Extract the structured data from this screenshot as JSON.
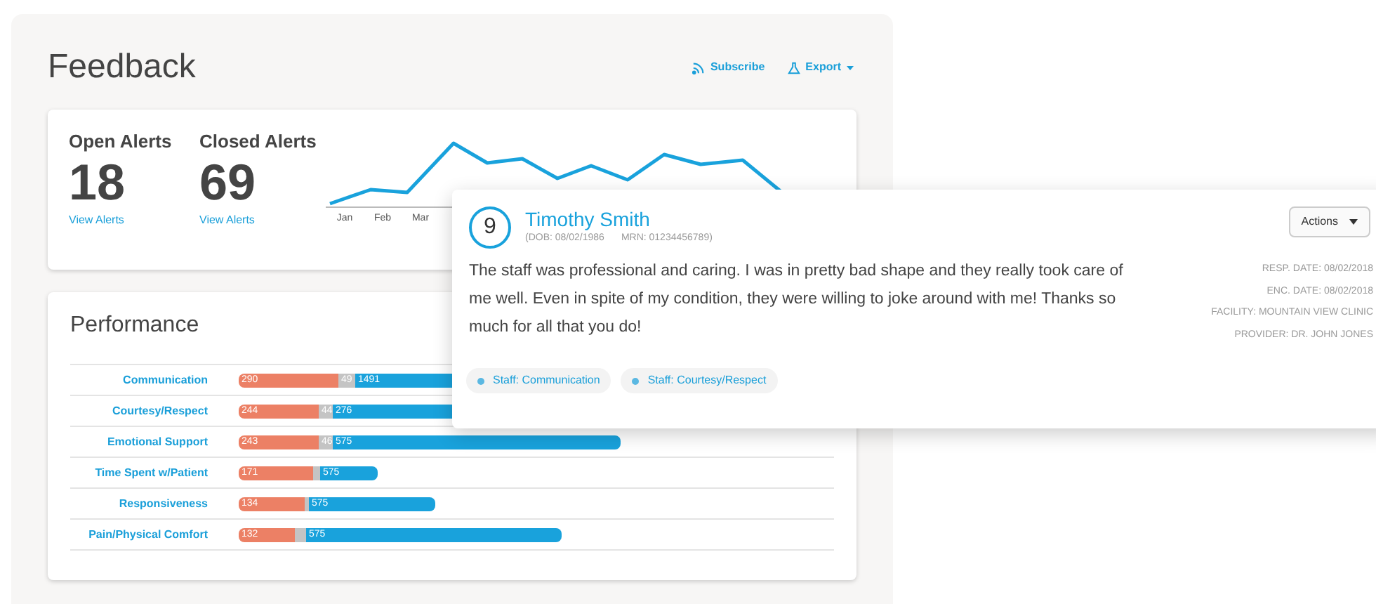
{
  "page": {
    "title": "Feedback",
    "links": [
      {
        "kind": "rss",
        "label": "Subscribe"
      },
      {
        "kind": "export",
        "label": "Export"
      }
    ]
  },
  "alerts": [
    {
      "title": "Open Alerts",
      "count": "18",
      "link": "View Alerts"
    },
    {
      "title": "Closed Alerts",
      "count": "69",
      "link": "View Alerts"
    }
  ],
  "trend": {
    "months": [
      "Jan",
      "Feb",
      "Mar"
    ]
  },
  "performance": {
    "title": "Performance",
    "rows": [
      {
        "label": "Communication",
        "segments": [
          {
            "kind": "negative",
            "text": "290"
          },
          {
            "kind": "neutral",
            "text": "49"
          },
          {
            "kind": "positive",
            "text": "1491"
          }
        ]
      },
      {
        "label": "Courtesy/Respect",
        "segments": [
          {
            "kind": "negative",
            "text": "244"
          },
          {
            "kind": "neutral",
            "text": "44"
          },
          {
            "kind": "positive",
            "text": "276"
          }
        ]
      },
      {
        "label": "Emotional Support",
        "segments": [
          {
            "kind": "negative",
            "text": "243"
          },
          {
            "kind": "neutral",
            "text": "46"
          },
          {
            "kind": "positive",
            "text": "575"
          }
        ]
      },
      {
        "label": "Time Spent w/Patient",
        "segments": [
          {
            "kind": "negative",
            "text": "171"
          },
          {
            "kind": "neutral"
          },
          {
            "kind": "positive",
            "text": "575"
          }
        ]
      },
      {
        "label": "Responsiveness",
        "segments": [
          {
            "kind": "negative",
            "text": "134"
          },
          {
            "kind": "neutral"
          },
          {
            "kind": "positive",
            "text": "575"
          }
        ]
      },
      {
        "label": "Pain/Physical Comfort",
        "segments": [
          {
            "kind": "negative",
            "text": "132"
          },
          {
            "kind": "neutral"
          },
          {
            "kind": "positive",
            "text": "575"
          }
        ]
      }
    ]
  },
  "feedback_card": {
    "score": "9",
    "name": "Timothy Smith",
    "dob": "(DOB: 08/02/1986",
    "mrn": "MRN: 01234456789)",
    "actions": "Actions",
    "comment": "The staff was professional and caring. I was in pretty bad shape and they really took care of me well. Even in spite of my condition, they were willing to joke around with me! Thanks so much for all that you do!",
    "details": [
      "RESP. DATE: 08/02/2018",
      "ENC. DATE: 08/02/2018",
      "FACILITY: MOUNTAIN VIEW CLINIC",
      "PROVIDER: DR. JOHN JONES"
    ],
    "tags": [
      "Staff: Communication",
      "Staff: Courtesy/Respect"
    ]
  }
}
